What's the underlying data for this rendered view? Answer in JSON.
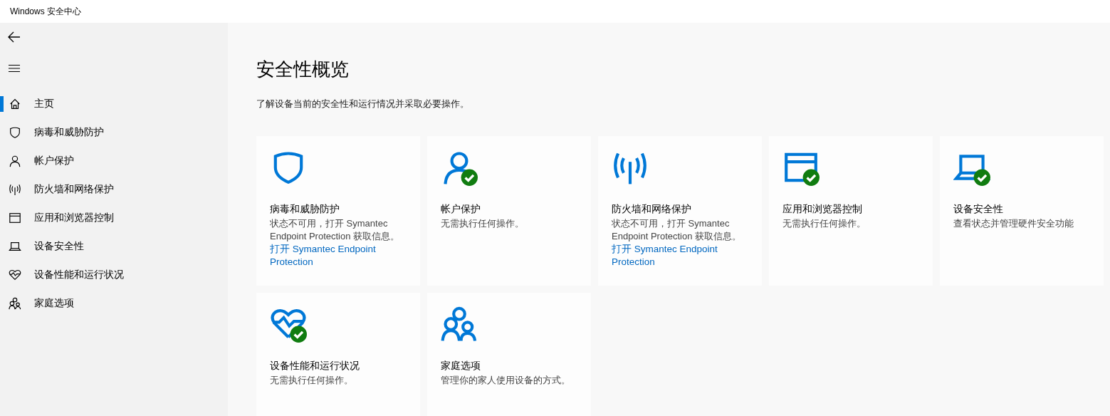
{
  "window": {
    "title": "Windows 安全中心"
  },
  "sidebar": {
    "items": [
      {
        "label": "主页",
        "kind": "home",
        "selected": true
      },
      {
        "label": "病毒和威胁防护",
        "kind": "shield",
        "selected": false
      },
      {
        "label": "帐户保护",
        "kind": "person",
        "selected": false
      },
      {
        "label": "防火墙和网络保护",
        "kind": "antenna",
        "selected": false
      },
      {
        "label": "应用和浏览器控制",
        "kind": "window",
        "selected": false
      },
      {
        "label": "设备安全性",
        "kind": "laptop",
        "selected": false
      },
      {
        "label": "设备性能和运行状况",
        "kind": "heart",
        "selected": false
      },
      {
        "label": "家庭选项",
        "kind": "family",
        "selected": false
      }
    ]
  },
  "page": {
    "title": "安全性概览",
    "subtitle": "了解设备当前的安全性和运行情况并采取必要操作。"
  },
  "cards": [
    {
      "kind": "shield",
      "ok": false,
      "title": "病毒和威胁防护",
      "description": "状态不可用，打开 Symantec Endpoint Protection 获取信息。",
      "link": "打开 Symantec Endpoint Protection"
    },
    {
      "kind": "person",
      "ok": true,
      "title": "帐户保护",
      "description": "无需执行任何操作。"
    },
    {
      "kind": "antenna",
      "ok": false,
      "title": "防火墙和网络保护",
      "description": "状态不可用，打开 Symantec Endpoint Protection 获取信息。",
      "link": "打开 Symantec Endpoint Protection"
    },
    {
      "kind": "window",
      "ok": true,
      "title": "应用和浏览器控制",
      "description": "无需执行任何操作。"
    },
    {
      "kind": "laptop",
      "ok": true,
      "title": "设备安全性",
      "description": "查看状态并管理硬件安全功能"
    },
    {
      "kind": "heart",
      "ok": true,
      "title": "设备性能和运行状况",
      "description": "无需执行任何操作。"
    },
    {
      "kind": "family",
      "ok": false,
      "title": "家庭选项",
      "description": "管理你的家人使用设备的方式。"
    }
  ]
}
